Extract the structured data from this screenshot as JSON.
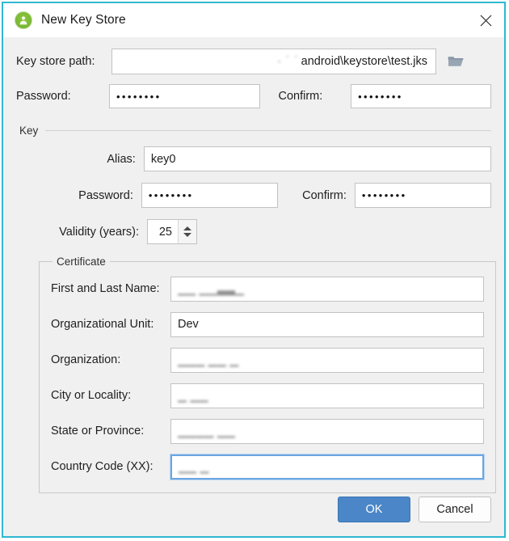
{
  "window": {
    "title": "New Key Store",
    "app_icon": "android-avatar-icon",
    "close_icon": "close-icon",
    "border_color": "#2eb8d0",
    "background": "#f0f0f0"
  },
  "keystore": {
    "path_label": "Key store path:",
    "path_value": "android\\keystore\\test.jks",
    "path_prefix_redacted": "· ˙ ˙",
    "browse_icon": "folder-icon",
    "password_label": "Password:",
    "password_value": "••••••••",
    "confirm_label": "Confirm:",
    "confirm_value": "••••••••"
  },
  "key_section": {
    "title": "Key",
    "alias_label": "Alias:",
    "alias_value": "key0",
    "password_label": "Password:",
    "password_value": "••••••••",
    "confirm_label": "Confirm:",
    "confirm_value": "••••••••",
    "validity_label": "Validity (years):",
    "validity_value": "25",
    "spinner_up_icon": "chevron-up-icon",
    "spinner_down_icon": "chevron-down-icon"
  },
  "certificate": {
    "title": "Certificate",
    "fields": [
      {
        "label": "First and Last Name:",
        "value": "▁▁ ▁▁▃▃▁",
        "redacted": true,
        "focused": false
      },
      {
        "label": "Organizational Unit:",
        "value": "Dev",
        "redacted": false,
        "focused": false
      },
      {
        "label": "Organization:",
        "value": "▁▁▁  ▁▁ ▁",
        "redacted": true,
        "focused": false
      },
      {
        "label": "City or Locality:",
        "value": "▁ ▁▁",
        "redacted": true,
        "focused": false
      },
      {
        "label": "State or Province:",
        "value": "▁▁▁▁ ▁▁",
        "redacted": true,
        "focused": false
      },
      {
        "label": "Country Code (XX):",
        "value": "▁▁ ▁",
        "redacted": true,
        "focused": true
      }
    ]
  },
  "footer": {
    "ok_label": "OK",
    "cancel_label": "Cancel",
    "ok_color": "#4a86c8"
  }
}
